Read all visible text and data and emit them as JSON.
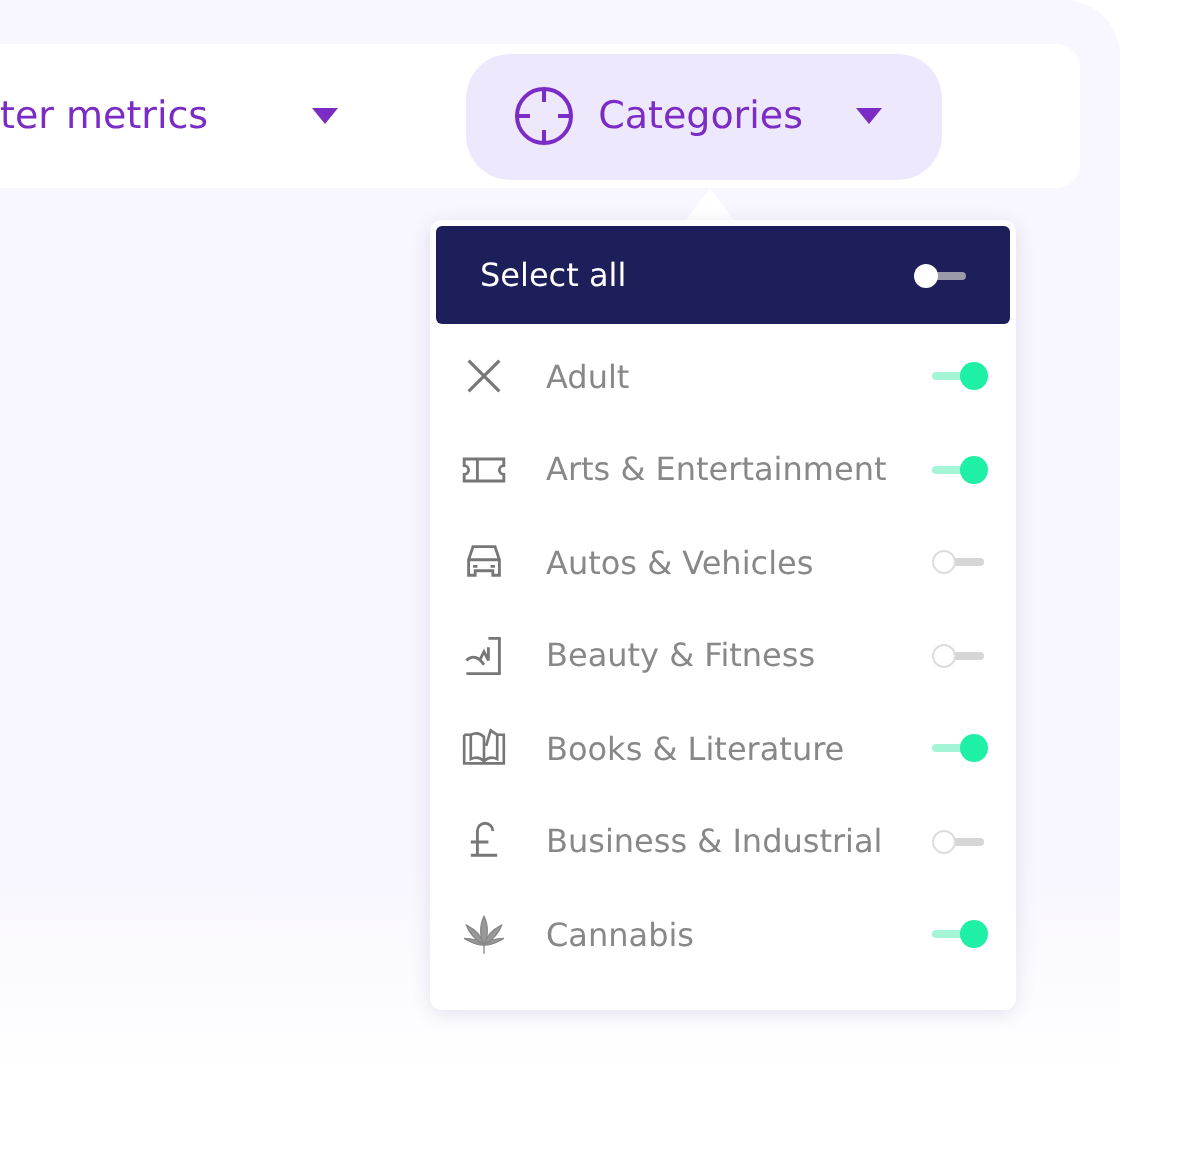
{
  "filter_bar": {
    "metrics_dropdown": {
      "label": "ter metrics"
    },
    "categories_dropdown": {
      "label": "Categories",
      "expanded": true
    }
  },
  "categories_menu": {
    "select_all": {
      "label": "Select all",
      "on": false
    },
    "items": [
      {
        "label": "Adult",
        "on": true
      },
      {
        "label": "Arts & Entertainment",
        "on": true
      },
      {
        "label": "Autos & Vehicles",
        "on": false
      },
      {
        "label": "Beauty & Fitness",
        "on": false
      },
      {
        "label": "Books & Literature",
        "on": true
      },
      {
        "label": "Business & Industrial",
        "on": false
      },
      {
        "label": "Cannabis",
        "on": true
      }
    ]
  }
}
